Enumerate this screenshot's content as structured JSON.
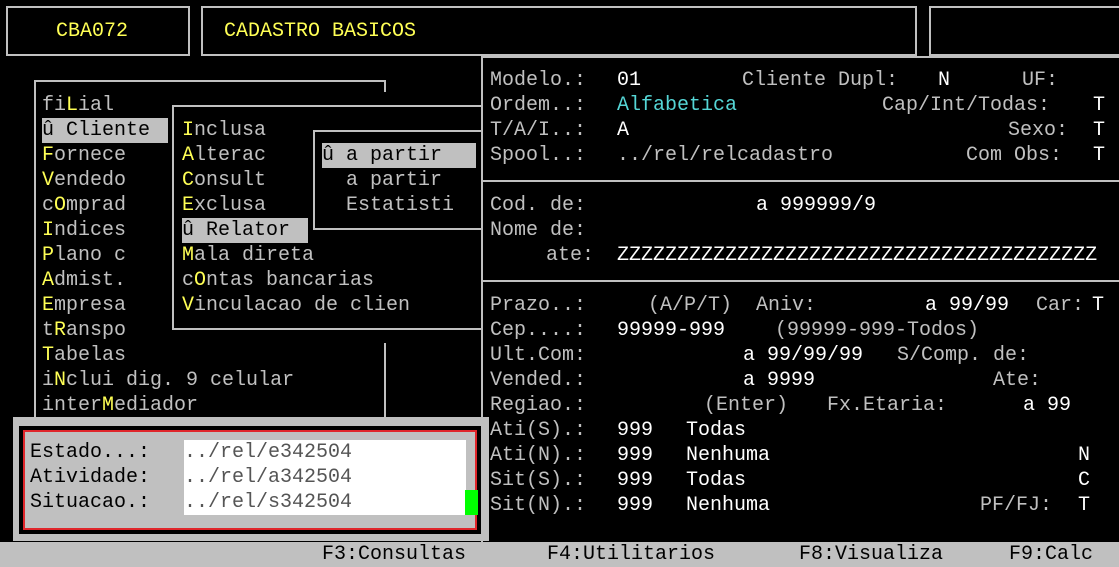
{
  "header": {
    "program_code": "CBA072",
    "title": "CADASTRO BASICOS"
  },
  "main_menu": {
    "items": [
      {
        "pre": "fi",
        "hot": "L",
        "post": "ial"
      },
      {
        "pre": "û ",
        "hot": "C",
        "post": "liente"
      },
      {
        "pre": "",
        "hot": "F",
        "post": "ornece"
      },
      {
        "pre": "",
        "hot": "V",
        "post": "endedo"
      },
      {
        "pre": "c",
        "hot": "O",
        "post": "mprad"
      },
      {
        "pre": "",
        "hot": "I",
        "post": "ndices"
      },
      {
        "pre": "",
        "hot": "P",
        "post": "lano c"
      },
      {
        "pre": "",
        "hot": "A",
        "post": "dmist."
      },
      {
        "pre": "",
        "hot": "E",
        "post": "mpresa"
      },
      {
        "pre": "t",
        "hot": "R",
        "post": "anspo"
      },
      {
        "pre": "",
        "hot": "T",
        "post": "abelas"
      },
      {
        "pre": "i",
        "hot": "N",
        "post": "clui dig. 9 celular"
      },
      {
        "pre": "inter",
        "hot": "M",
        "post": "ediador"
      }
    ]
  },
  "cliente_menu": {
    "items": [
      {
        "pre": "",
        "hot": "I",
        "post": "nclusa"
      },
      {
        "pre": "",
        "hot": "A",
        "post": "lterac"
      },
      {
        "pre": "",
        "hot": "C",
        "post": "onsult"
      },
      {
        "pre": "",
        "hot": "E",
        "post": "xclusa"
      },
      {
        "pre": "û ",
        "hot": "R",
        "post": "elator"
      },
      {
        "pre": "",
        "hot": "M",
        "post": "ala direta"
      },
      {
        "pre": "c",
        "hot": "O",
        "post": "ntas bancarias"
      },
      {
        "pre": "",
        "hot": "V",
        "post": "inculacao de clien"
      }
    ]
  },
  "relatorio_menu": {
    "items": [
      "û a partir",
      "  a partir",
      "  Estatisti"
    ]
  },
  "params": {
    "modelo_label": "Modelo.:",
    "modelo_value": "01",
    "cliente_dupl_label": "Cliente Dupl:",
    "cliente_dupl_value": "N",
    "uf_label": "UF:",
    "ordem_label": "Ordem..:",
    "ordem_value": "Alfabetica",
    "cap_label": "Cap/Int/Todas:",
    "cap_value": "T",
    "tai_label": "T/A/I..:",
    "tai_value": "A",
    "sexo_label": "Sexo:",
    "sexo_value": "T",
    "spool_label": "Spool..:",
    "spool_value": "../rel/relcadastro",
    "com_obs_label": "Com Obs:",
    "com_obs_value": "T"
  },
  "code_range": {
    "cod_label": "Cod. de:",
    "cod_value": "a 999999/9",
    "nome_label": "Nome de:",
    "ate_label": "ate:",
    "ate_value": "ZZZZZZZZZZZZZZZZZZZZZZZZZZZZZZZZZZZZZZZZ"
  },
  "filters": {
    "prazo_label": "Prazo..:",
    "prazo_value": "(A/P/T)",
    "aniv_label": "Aniv:",
    "aniv_value": "a 99/99",
    "car_label": "Car:",
    "car_value": "T",
    "cep_label": "Cep....:",
    "cep_value": "99999-999",
    "cep_hint": "(99999-999-Todos)",
    "ultcom_label": "Ult.Com:",
    "ultcom_value": "a 99/99/99",
    "scomp_label": "S/Comp. de:",
    "vended_label": "Vended.:",
    "vended_value": "a 9999",
    "ate_label": "Ate:",
    "regiao_label": "Regiao.:",
    "regiao_value": "(Enter)",
    "fx_label": "Fx.Etaria:",
    "fx_value": "a 99",
    "ati_s_label": "Ati(S).:",
    "ati_s_value": "999",
    "ati_s_desc": "Todas",
    "ati_n_label": "Ati(N).:",
    "ati_n_value": "999",
    "ati_n_desc": "Nenhuma",
    "ati_n_flag": "N",
    "sit_s_label": "Sit(S).:",
    "sit_s_value": "999",
    "sit_s_desc": "Todas",
    "sit_s_flag": "C",
    "sit_n_label": "Sit(N).:",
    "sit_n_value": "999",
    "sit_n_desc": "Nenhuma",
    "pffj_label": "PF/FJ:",
    "pffj_value": "T"
  },
  "popup": {
    "estado_label": "Estado...:",
    "estado_value": "../rel/e342504",
    "atividade_label": "Atividade:",
    "atividade_value": "../rel/a342504",
    "situacao_label": "Situacao.:",
    "situacao_value": "../rel/s342504"
  },
  "function_keys": [
    "F3:Consultas",
    "F4:Utilitarios",
    "F8:Visualiza",
    "F9:Calc"
  ],
  "colors": {
    "background": "#000000",
    "text": "#c0c0c0",
    "hotkey": "#ffff55",
    "highlight_value": "#55d6d6",
    "selection_bg": "#c0c0c0",
    "popup_border": "#e0262b",
    "cursor": "#00ff00"
  }
}
